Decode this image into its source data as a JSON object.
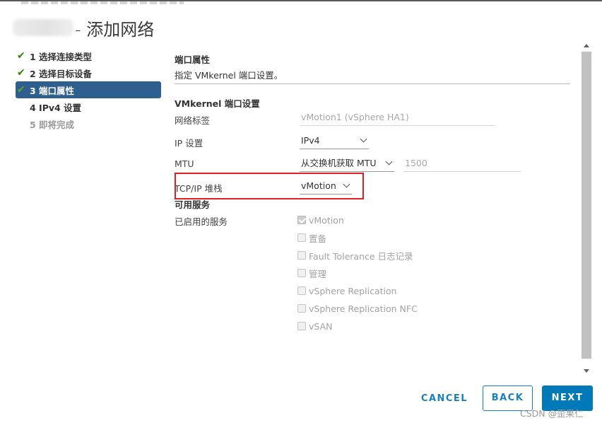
{
  "header": {
    "title": "- 添加网络"
  },
  "steps": [
    {
      "label": "1 选择连接类型",
      "state": "done",
      "icon": "check-icon"
    },
    {
      "label": "2 选择目标设备",
      "state": "done",
      "icon": "check-icon"
    },
    {
      "label": "3 端口属性",
      "state": "active",
      "icon": "check-icon"
    },
    {
      "label": "4 IPv4 设置",
      "state": "todo",
      "icon": ""
    },
    {
      "label": "5 即将完成",
      "state": "future",
      "icon": ""
    }
  ],
  "main": {
    "section_title": "端口属性",
    "description": "指定 VMkernel 端口设置。",
    "settings_title": "VMkernel 端口设置",
    "network_label": {
      "label": "网络标签",
      "value": "vMotion1 (vSphere HA1)"
    },
    "ip_settings": {
      "label": "IP 设置",
      "value": "IPv4"
    },
    "mtu": {
      "label": "MTU",
      "mode": "从交换机获取 MTU",
      "value": "1500"
    },
    "tcpip_stack": {
      "label": "TCP/IP 堆栈",
      "value": "vMotion"
    },
    "services_title": "可用服务",
    "enabled_services_label": "已启用的服务",
    "services": [
      {
        "label": "vMotion",
        "checked": true
      },
      {
        "label": "置备",
        "checked": false
      },
      {
        "label": "Fault Tolerance 日志记录",
        "checked": false
      },
      {
        "label": "管理",
        "checked": false
      },
      {
        "label": "vSphere Replication",
        "checked": false
      },
      {
        "label": "vSphere Replication NFC",
        "checked": false
      },
      {
        "label": "vSAN",
        "checked": false
      }
    ]
  },
  "footer": {
    "cancel": "CANCEL",
    "back": "BACK",
    "next": "NEXT"
  },
  "watermark": "CSDN @歪果仁",
  "colors": {
    "accent": "#0079b8",
    "active_step_bg": "#2f5f8f",
    "check": "#2f8400",
    "highlight_box": "#e02020"
  }
}
